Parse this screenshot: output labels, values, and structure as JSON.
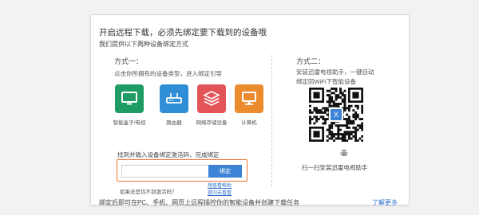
{
  "dialog": {
    "title": "开启远程下载，必须先绑定要下载到的设备哦",
    "subtitle": "我们提供以下两种设备绑定方式"
  },
  "method1": {
    "heading": "方式一：",
    "description": "点击你所拥有的设备类型，进入绑定引导",
    "devices": [
      {
        "label": "智能盒子/电视",
        "icon": "tv-icon",
        "color": "#1f9c63"
      },
      {
        "label": "路由器",
        "icon": "router-icon",
        "color": "#2f8ed6"
      },
      {
        "label": "网络存储设备",
        "icon": "storage-icon",
        "color": "#e25457"
      },
      {
        "label": "计算机",
        "icon": "computer-icon",
        "color": "#ec8a2e"
      }
    ],
    "find_code_text": "找到并输入设备绑定激活码，完成绑定",
    "code_input": {
      "value": "",
      "placeholder": ""
    },
    "bind_button": "绑定",
    "no_code_text": "如果还是找不到激活码？",
    "link_view_help": "想查看帮助",
    "link_ask": "提问去看看"
  },
  "method2": {
    "heading": "方式二：",
    "description_line1": "安装迅雷电视助手，一键自动",
    "description_line2": "绑定同WiFi下智能设备",
    "qr_logo": "X",
    "platform_icons": [
      "apple-icon",
      "android-icon"
    ],
    "scan_text": "扫一扫安装迅雷电视助手"
  },
  "footer": {
    "note": "绑定后即可在PC、手机、网页上远程操控你的智能设备并创建下载任务",
    "learn_more": "了解更多"
  },
  "colors": {
    "accent": "#3e84d6",
    "highlight": "#e8732e"
  }
}
